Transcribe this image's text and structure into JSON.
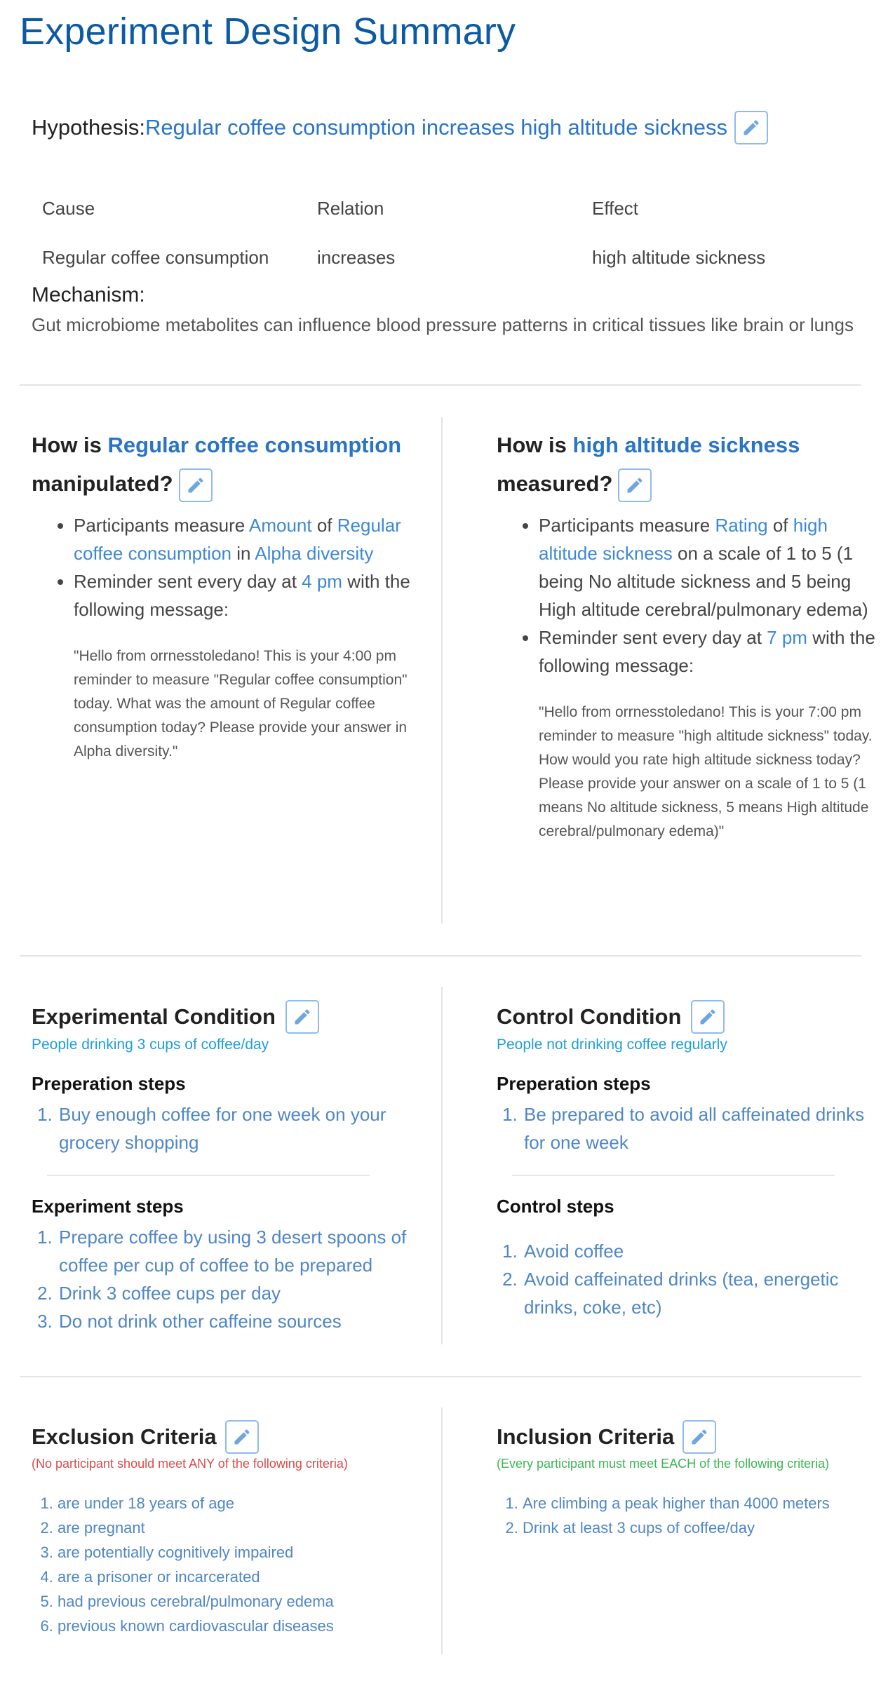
{
  "page_title": "Experiment Design Summary",
  "hypothesis": {
    "label": "Hypothesis:",
    "text": "Regular coffee consumption increases high altitude sickness"
  },
  "crt": {
    "headers": [
      "Cause",
      "Relation",
      "Effect"
    ],
    "values": [
      "Regular coffee consumption",
      "increases",
      "high altitude sickness"
    ]
  },
  "mechanism": {
    "label": "Mechanism:",
    "text": "Gut microbiome metabolites can influence blood pressure patterns in critical tissues like brain or lungs"
  },
  "manipulation": {
    "prefix": "How is ",
    "variable": "Regular coffee consumption",
    "suffix": "manipulated?",
    "b1_a": "Participants measure ",
    "b1_measure": "Amount",
    "b1_b": " of ",
    "b1_variable": "Regular coffee consumption",
    "b1_c": " in ",
    "b1_unit": "Alpha diversity",
    "b2_a": "Reminder sent every day at ",
    "b2_time": "4 pm",
    "b2_b": " with the following message:",
    "message": "\"Hello from orrnesstoledano! This is your 4:00 pm reminder to measure \"Regular coffee consumption\" today.   What was the amount of Regular coffee consumption today? Please provide your answer in Alpha diversity.\""
  },
  "measurement": {
    "prefix": "How is ",
    "variable": "high altitude sickness",
    "suffix": "measured?",
    "b1_a": "Participants measure ",
    "b1_measure": "Rating",
    "b1_b": " of ",
    "b1_variable": "high altitude sickness",
    "b1_c": " on a scale of 1 to 5 (1 being No altitude sickness and 5 being High altitude cerebral/pulmonary edema)",
    "b2_a": "Reminder sent every day at ",
    "b2_time": "7 pm",
    "b2_b": " with the following message:",
    "message": "\"Hello from orrnesstoledano! This is your 7:00 pm reminder to measure \"high altitude sickness\" today.   How would you rate high altitude sickness today? Please provide your answer on a scale of 1 to 5 (1 means No altitude sickness, 5 means High altitude cerebral/pulmonary edema)\""
  },
  "experimental": {
    "title": "Experimental Condition",
    "subtitle": "People drinking 3 cups of coffee/day",
    "prep_title": "Preperation steps",
    "prep_steps": [
      "Buy enough coffee for one week on your grocery shopping"
    ],
    "steps_title": "Experiment steps",
    "steps": [
      "Prepare coffee by using 3 desert spoons of coffee per cup of coffee to be prepared",
      "Drink 3 coffee cups per day",
      "Do not drink other caffeine sources"
    ]
  },
  "control": {
    "title": "Control Condition",
    "subtitle": "People not drinking coffee regularly",
    "prep_title": "Preperation steps",
    "prep_steps": [
      "Be prepared to avoid all caffeinated drinks for one week"
    ],
    "steps_title": "Control steps",
    "steps": [
      "Avoid coffee",
      "Avoid caffeinated drinks (tea, energetic drinks, coke, etc)"
    ]
  },
  "exclusion": {
    "title": "Exclusion Criteria",
    "subtitle": "(No participant should meet ANY of the following criteria)",
    "items": [
      "are under 18 years of age",
      "are pregnant",
      "are potentially cognitively impaired",
      "are a prisoner or incarcerated",
      "had previous cerebral/pulmonary edema",
      "previous known cardiovascular diseases"
    ]
  },
  "inclusion": {
    "title": "Inclusion Criteria",
    "subtitle": "(Every participant must meet EACH of the following criteria)",
    "items": [
      "Are climbing a peak higher than 4000 meters",
      "Drink at least 3 cups of coffee/day"
    ]
  },
  "colors": {
    "title": "#0b5aa2",
    "link": "#2a74c8",
    "list": "#4f86c6",
    "subtitle_blue": "#1e9fd8",
    "exclusion_red": "#d94a4a",
    "inclusion_green": "#3db557",
    "edit_border": "#8fbbe8"
  },
  "icons": {
    "edit": "pencil-icon"
  }
}
